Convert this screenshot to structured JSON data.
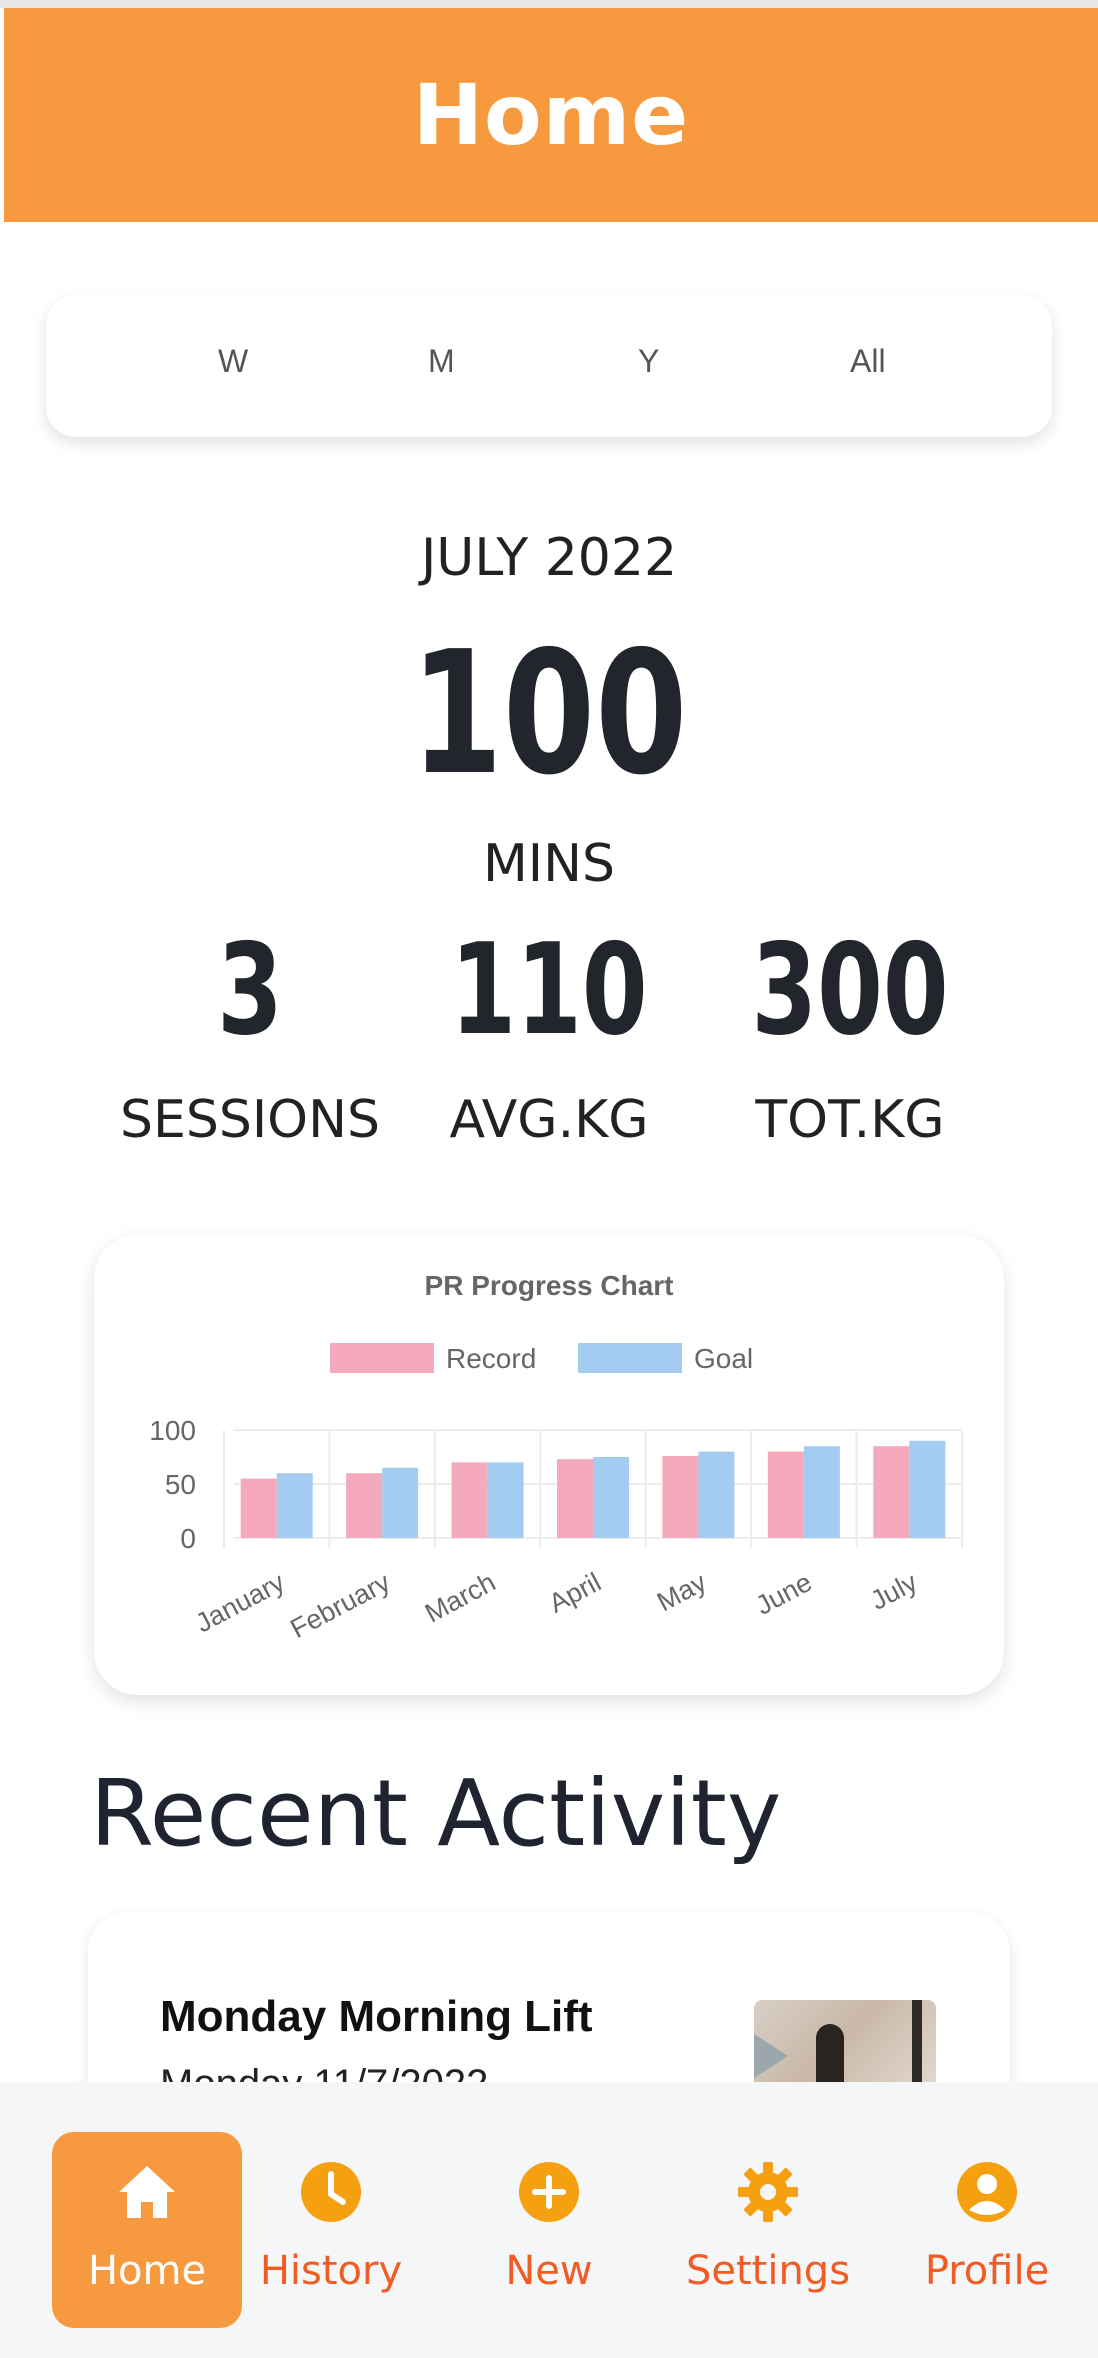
{
  "header": {
    "title": "Home"
  },
  "range": {
    "options": [
      "W",
      "M",
      "Y",
      "All"
    ]
  },
  "summary": {
    "period": "JULY 2022",
    "main_value": "100",
    "main_unit": "MINS",
    "stats": [
      {
        "value": "3",
        "label": "SESSIONS"
      },
      {
        "value": "110",
        "label": "AVG.KG"
      },
      {
        "value": "300",
        "label": "TOT.KG"
      }
    ]
  },
  "chart_data": {
    "type": "bar",
    "title": "PR Progress Chart",
    "categories": [
      "January",
      "February",
      "March",
      "April",
      "May",
      "June",
      "July"
    ],
    "series": [
      {
        "name": "Record",
        "color": "#f4a9bc",
        "values": [
          55,
          60,
          70,
          73,
          76,
          80,
          85
        ]
      },
      {
        "name": "Goal",
        "color": "#a4ccf0",
        "values": [
          60,
          65,
          70,
          75,
          80,
          85,
          90
        ]
      }
    ],
    "yticks": [
      0,
      50,
      100
    ],
    "ylim": [
      0,
      100
    ],
    "legend": "top",
    "grid": true
  },
  "recent": {
    "title": "Recent Activity",
    "items": [
      {
        "title": "Monday Morning Lift",
        "date": "Monday 11/7/2022"
      }
    ]
  },
  "nav": {
    "items": [
      {
        "label": "Home",
        "icon": "home-icon",
        "active": true
      },
      {
        "label": "History",
        "icon": "clock-icon",
        "active": false
      },
      {
        "label": "New",
        "icon": "plus-circle-icon",
        "active": false
      },
      {
        "label": "Settings",
        "icon": "gear-icon",
        "active": false
      },
      {
        "label": "Profile",
        "icon": "user-circle-icon",
        "active": false
      }
    ]
  },
  "colors": {
    "accent": "#f79a3f",
    "nav_text": "#f05c23",
    "icon": "#f5a011"
  }
}
